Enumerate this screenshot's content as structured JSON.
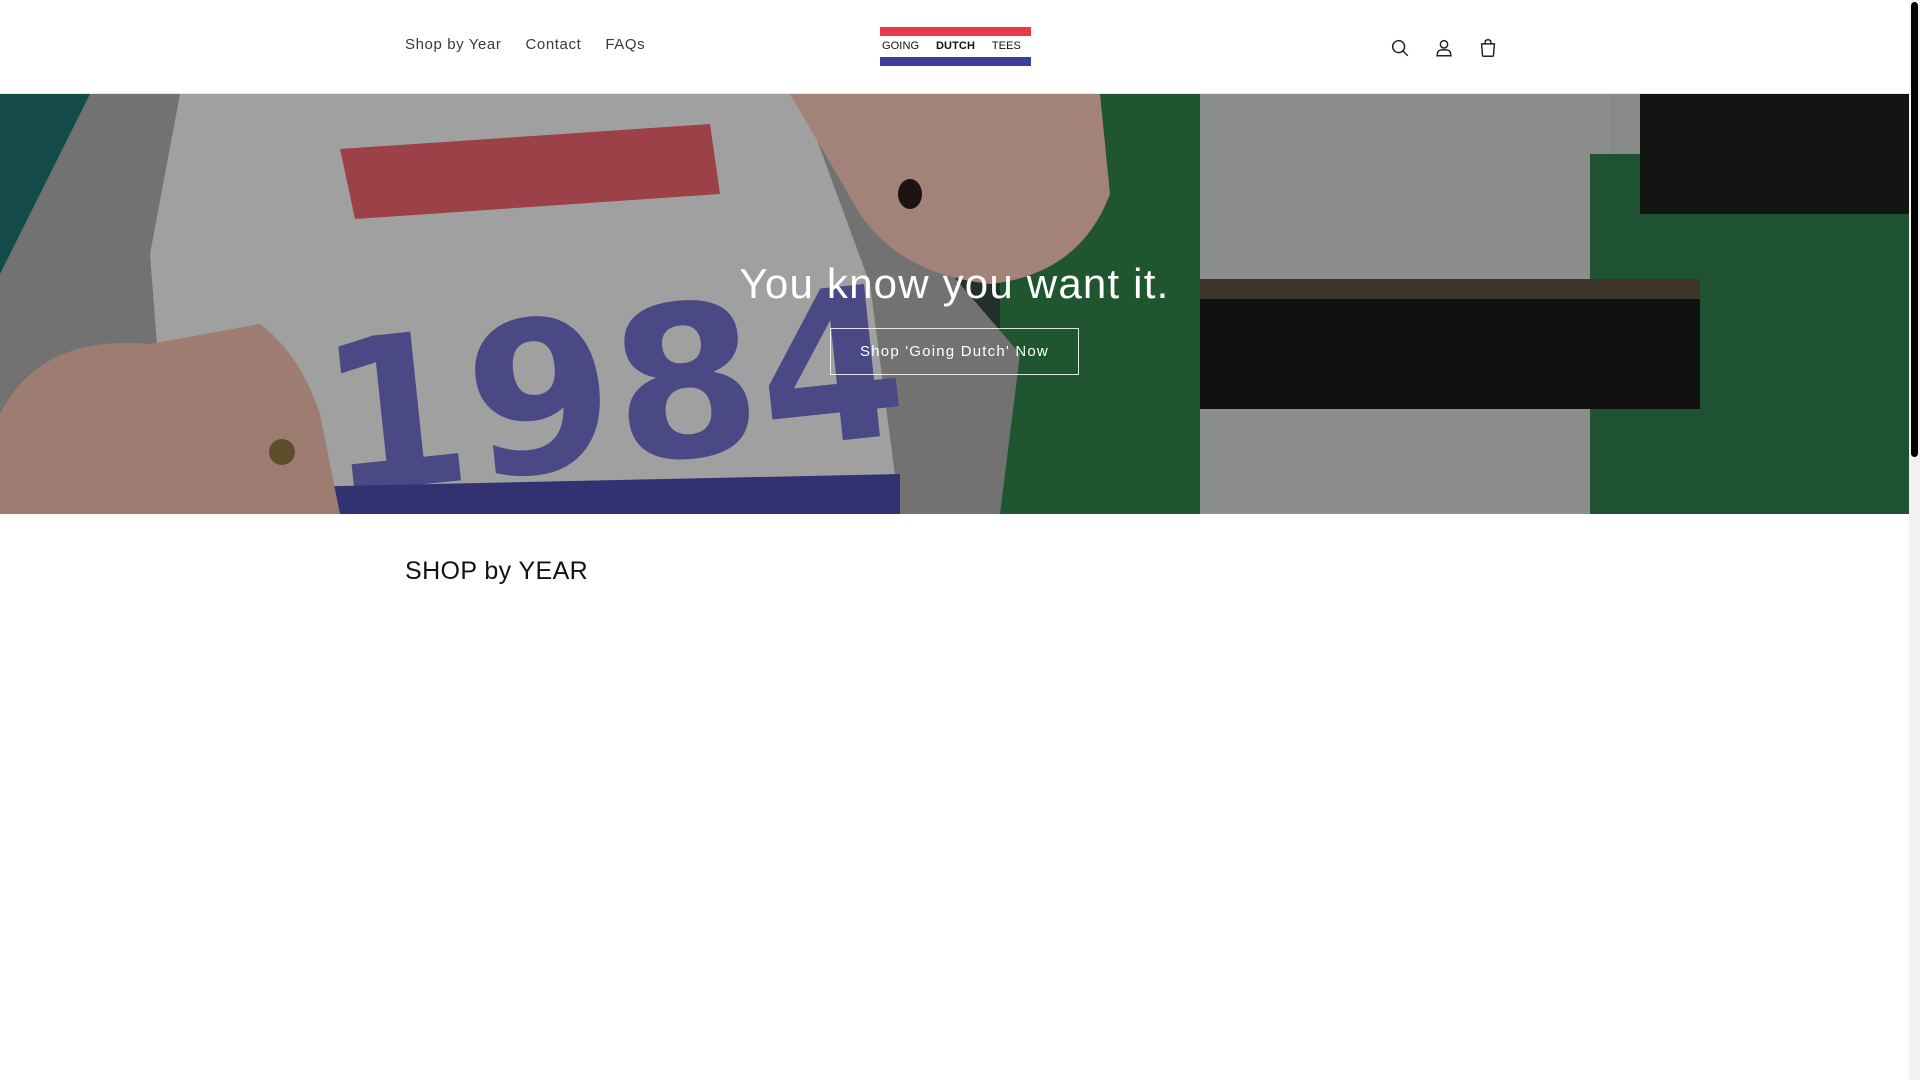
{
  "header": {
    "nav": [
      {
        "label": "Shop by Year"
      },
      {
        "label": "Contact"
      },
      {
        "label": "FAQs"
      }
    ],
    "logo": {
      "words": [
        "GOING",
        "DUTCH",
        "TEES"
      ],
      "colors": {
        "top": "#e8394a",
        "bottom": "#3b3f97"
      }
    },
    "icons": [
      "search-icon",
      "account-icon",
      "cart-icon"
    ]
  },
  "hero": {
    "heading": "You know you want it.",
    "button_label": "Shop 'Going Dutch' Now",
    "image_print_text": "1984"
  },
  "collection": {
    "title": "SHOP by YEAR"
  },
  "colors": {
    "accent_red": "#e8394a",
    "accent_blue": "#3b3f97",
    "text": "#121212"
  }
}
